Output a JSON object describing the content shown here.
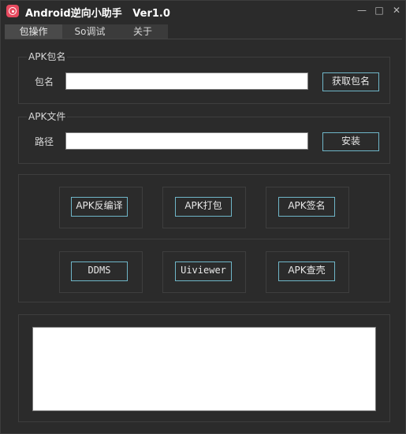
{
  "window": {
    "title": "Android逆向小助手   Ver1.0",
    "icon": "app-logo-icon",
    "controls": {
      "minimize": "—",
      "maximize": "□",
      "close": "✕"
    }
  },
  "tabs": [
    {
      "label": "包操作",
      "active": true
    },
    {
      "label": "So调试",
      "active": false
    },
    {
      "label": "关于",
      "active": false
    }
  ],
  "package_group": {
    "legend": "APK包名",
    "field_label": "包名",
    "value": "",
    "button": "获取包名"
  },
  "file_group": {
    "legend": "APK文件",
    "field_label": "路径",
    "value": "",
    "button": "安装"
  },
  "tools": {
    "buttons": [
      "APK反编译",
      "APK打包",
      "APK签名",
      "DDMS",
      "Uiviewer",
      "APK查壳"
    ]
  },
  "output": {
    "value": ""
  },
  "colors": {
    "background": "#2b2b2b",
    "button_border": "#6fb6c8",
    "text": "#d8d8d8"
  }
}
